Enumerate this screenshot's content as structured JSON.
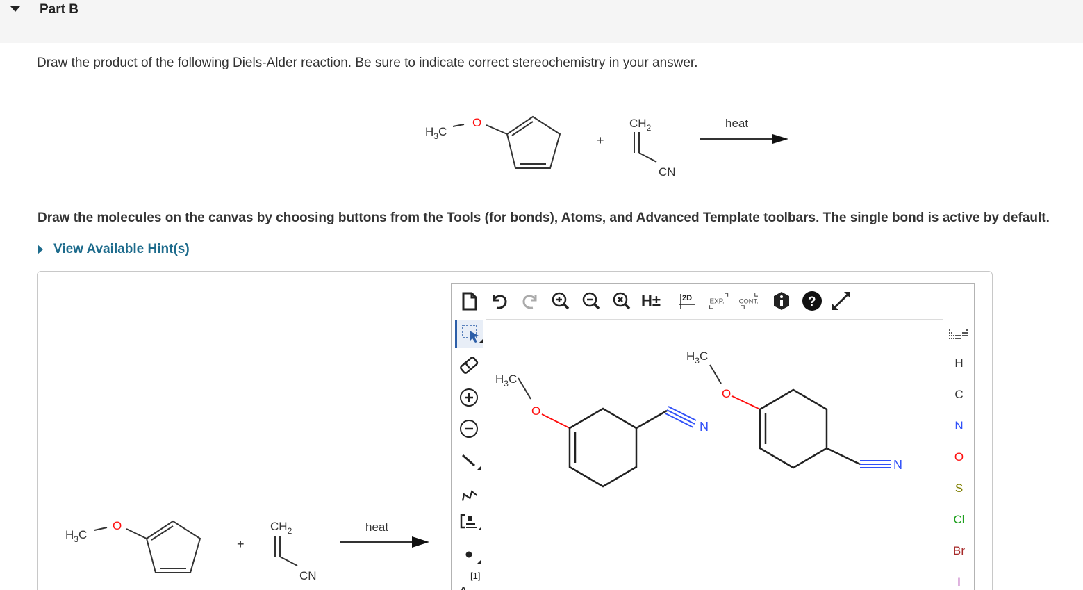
{
  "part": {
    "title": "Part B"
  },
  "question": {
    "text": "Draw the product of the following Diels-Alder reaction. Be sure to indicate correct stereochemistry in your answer."
  },
  "reaction": {
    "methyl_label": "H3C",
    "oxygen_label": "O",
    "plus": "+",
    "ch2_label": "CH2",
    "cn_label": "CN",
    "condition": "heat"
  },
  "instructions": {
    "text": "Draw the molecules on the canvas by choosing buttons from the Tools (for bonds), Atoms, and Advanced Template toolbars. The single bond is active by default."
  },
  "hint": {
    "label": "View Available Hint(s)"
  },
  "editor": {
    "toolbar": {
      "clear_icon": "new-document-icon",
      "undo_icon": "undo-icon",
      "redo_icon": "redo-icon",
      "zoom_in_icon": "zoom-in-icon",
      "zoom_out_icon": "zoom-out-icon",
      "zoom_reset_icon": "zoom-reset-icon",
      "hydrogens_label": "H±",
      "clean2d_label": "2D",
      "expand_label": "EXP.",
      "contract_label": "CONT.",
      "info_icon": "info-icon",
      "help_icon": "help-icon",
      "fullscreen_icon": "fullscreen-icon"
    },
    "tools": [
      "select-icon",
      "eraser-icon",
      "positive-charge-icon",
      "negative-charge-icon",
      "single-bond-icon",
      "chain-icon",
      "bracket-icon",
      "radical-icon",
      "atom-map-icon"
    ],
    "atom_map_label": "[1]",
    "atoms": [
      {
        "symbol": "H",
        "color": "#333333"
      },
      {
        "symbol": "C",
        "color": "#333333"
      },
      {
        "symbol": "N",
        "color": "#3050f8"
      },
      {
        "symbol": "O",
        "color": "#ff0d0d"
      },
      {
        "symbol": "S",
        "color": "#7f7f00"
      },
      {
        "symbol": "Cl",
        "color": "#1fa01f"
      },
      {
        "symbol": "Br",
        "color": "#a62929"
      },
      {
        "symbol": "I",
        "color": "#940094"
      }
    ],
    "canvas": {
      "product1": {
        "methyl": "H3C",
        "oxygen": "O",
        "nitrogen": "N"
      },
      "product2": {
        "methyl": "H3C",
        "oxygen": "O",
        "nitrogen": "N"
      }
    }
  }
}
